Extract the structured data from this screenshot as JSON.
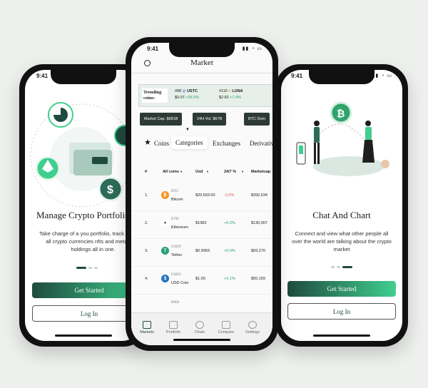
{
  "left": {
    "time": "9:41",
    "title": "Manage Crypto Portfolio",
    "body": "Take charge of a you portfolio, track and sync all crypto currencies nfts and metaverse holdings all in one.",
    "primary_button": "Get Started",
    "secondary_button": "Log In"
  },
  "center": {
    "time": "9:41",
    "title": "Market",
    "trending_label": "Trending coins:",
    "trending": [
      {
        "rank": "#88",
        "symbol": "USTC",
        "price": "$0.07",
        "change": "+95.0%"
      },
      {
        "rank": "#110",
        "symbol": "LUNA",
        "price": "$2.82",
        "change": "+7.4%"
      }
    ],
    "stats": [
      {
        "label": "Market Cap.",
        "value": "$981B"
      },
      {
        "label": "24H Vol.",
        "value": "$67B"
      },
      {
        "label": "BTC Dom",
        "value": ""
      }
    ],
    "tabs": [
      "Coins",
      "Categories",
      "Exchanges",
      "Derivatives"
    ],
    "active_tab": "Categories",
    "columns": [
      "#",
      "All coins",
      "Usd",
      "24/7 %",
      "Marketcap"
    ],
    "rows": [
      {
        "rank": "1.",
        "symbol": "BTC",
        "name": "Bitcoin",
        "price": "$20,593.00",
        "change": "-2.6%",
        "mcap": "$392,634"
      },
      {
        "rank": "2.",
        "symbol": "ETH",
        "name": "Ethereum",
        "price": "$1083",
        "change": "+0.3%",
        "mcap": "$130,907"
      },
      {
        "rank": "3.",
        "symbol": "USDT",
        "name": "Tether",
        "price": "$0.9959",
        "change": "+0.0%",
        "mcap": "$69,270"
      },
      {
        "rank": "4.",
        "symbol": "USDC",
        "name": "USD Coin",
        "price": "$1.00",
        "change": "+0.1%",
        "mcap": "$55,159"
      },
      {
        "rank": "",
        "symbol": "BNB",
        "name": "",
        "price": "",
        "change": "",
        "mcap": ""
      }
    ],
    "nav": [
      "Markets",
      "Portfolio",
      "Chats",
      "Compare",
      "Settings"
    ]
  },
  "right": {
    "time": "9:41",
    "title": "Chat And Chart",
    "body": "Connect and view what other people all over the world are talking about the crypto market",
    "primary_button": "Get Started",
    "secondary_button": "Log In"
  },
  "colors": {
    "accent": "#1f4b3f",
    "green": "#3fcf8e",
    "red": "#e05555",
    "bg": "#eef0ee"
  }
}
